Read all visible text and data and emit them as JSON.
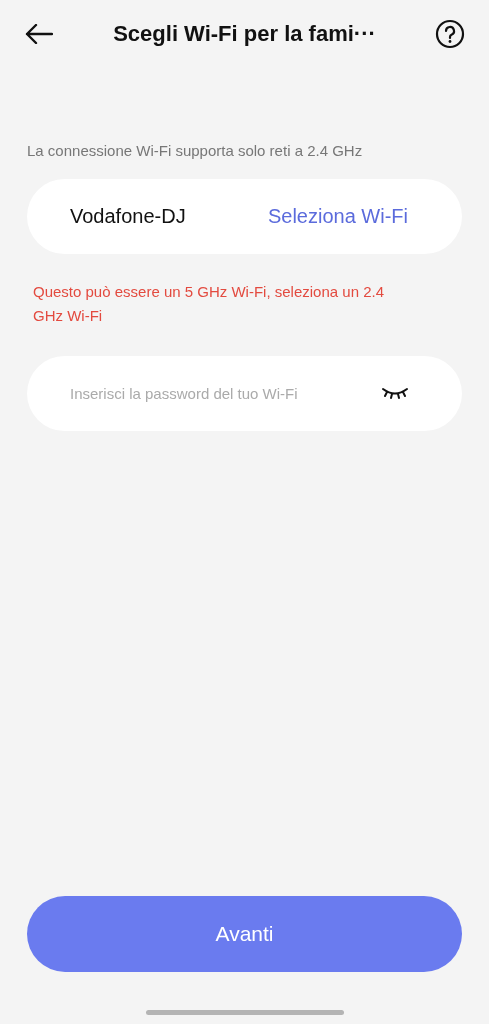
{
  "header": {
    "title": "Scegli Wi-Fi per la fami···"
  },
  "info": "La connessione Wi-Fi supporta solo reti a 2.4 GHz",
  "network": {
    "name": "Vodafone-DJ",
    "action": "Seleziona Wi-Fi"
  },
  "warning": "Questo può essere un 5 GHz Wi-Fi, seleziona un 2.4 GHz Wi-Fi",
  "password": {
    "placeholder": "Inserisci la password del tuo Wi-Fi",
    "visible": false
  },
  "button": "Avanti"
}
